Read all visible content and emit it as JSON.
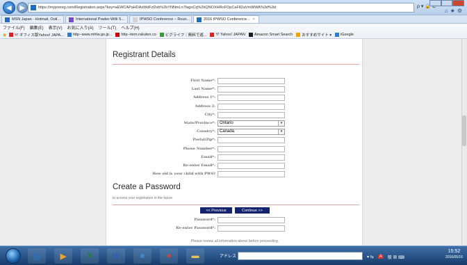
{
  "browser": {
    "address": "https://myprereg.com/Registration.aspx?key=aEWCAPaHDAxWdFzDvb%2bYNNmLn7fagoCq%2bQNOXHRoFOpCaF82aVmWWA%3d%3d",
    "address_host": "https://myprereg.com",
    "tabs": [
      {
        "label": "MSN Japan - Hotmail, Outl...",
        "color": "#2a6ac4"
      },
      {
        "label": "International Prader-Willi S...",
        "color": "#7a4bc9"
      },
      {
        "label": "IPWSO Conference – Roun...",
        "color": "#d2d2d2"
      },
      {
        "label": "2016 IPWSO Conference...",
        "color": "#1d6fbf",
        "close": "×"
      }
    ],
    "menu": [
      "ファイル(F)",
      "編集(E)",
      "表示(V)",
      "お気に入り(A)",
      "ツール(T)",
      "ヘルプ(H)"
    ],
    "favorites": [
      {
        "label": "Y! オフィス版Yahoo! JAPA...",
        "color": "#d22"
      },
      {
        "label": "http--www.mhlw.go.jp...",
        "color": "#2b7cd3"
      },
      {
        "label": "http--item.rakuten.co",
        "color": "#c00"
      },
      {
        "label": "ビグライフ｜無料で遊...",
        "color": "#3a9a3a"
      },
      {
        "label": "Y! Yahoo! JAPAN",
        "color": "#d22"
      },
      {
        "label": "Amazon Smart Search",
        "color": "#1a1a1a"
      },
      {
        "label": "おすすめサイト ▾",
        "color": "#f0a000"
      },
      {
        "label": "iGoogle",
        "color": "#2b7cd3"
      }
    ],
    "tools_icons": "ρ ▾ 🔒 C"
  },
  "form": {
    "registrant_title": "Registrant Details",
    "fields": [
      {
        "label": "First Name*:",
        "value": ""
      },
      {
        "label": "Last Name*:",
        "value": ""
      },
      {
        "label": "Address 1*:",
        "value": ""
      },
      {
        "label": "Address 2:",
        "value": ""
      },
      {
        "label": "City*:",
        "value": ""
      },
      {
        "label": "State/Province*:",
        "value": "Ontario",
        "select": true
      },
      {
        "label": "Country*:",
        "value": "Canada",
        "select": true
      },
      {
        "label": "Postal/Zip*:",
        "value": ""
      },
      {
        "label": "Phone Number*:",
        "value": ""
      },
      {
        "label": "Email*:",
        "value": ""
      },
      {
        "label": "Re-enter Email*:",
        "value": ""
      },
      {
        "label": "How old is your child with PWS?",
        "value": ""
      }
    ],
    "password_title": "Create a Password",
    "password_subtitle": "to access your registration in the future",
    "password_fields": [
      {
        "label": "Password*:",
        "value": ""
      },
      {
        "label": "Re-enter Password*:",
        "value": ""
      }
    ],
    "review_note": "Please review all information above before proceeding.",
    "prev_button": "<< Previous",
    "continue_button": "Continue >>"
  },
  "taskbar": {
    "address_label": "アドレス",
    "clock_time": "15:52",
    "clock_date": "2016/05/16",
    "pinned": [
      {
        "name": "explorer",
        "color": "#2f6fb3",
        "glyph": "▤"
      },
      {
        "name": "media",
        "color": "#e8a230",
        "glyph": "▶"
      },
      {
        "name": "excel",
        "color": "#1f7a3a",
        "glyph": "X"
      },
      {
        "name": "word",
        "color": "#2b5fb3",
        "glyph": "W"
      },
      {
        "name": "ie",
        "color": "#3d9ad9",
        "glyph": "e"
      },
      {
        "name": "chrome",
        "color": "#d9452b",
        "glyph": "●"
      },
      {
        "name": "folder",
        "color": "#e8c25a",
        "glyph": "▬"
      }
    ]
  }
}
